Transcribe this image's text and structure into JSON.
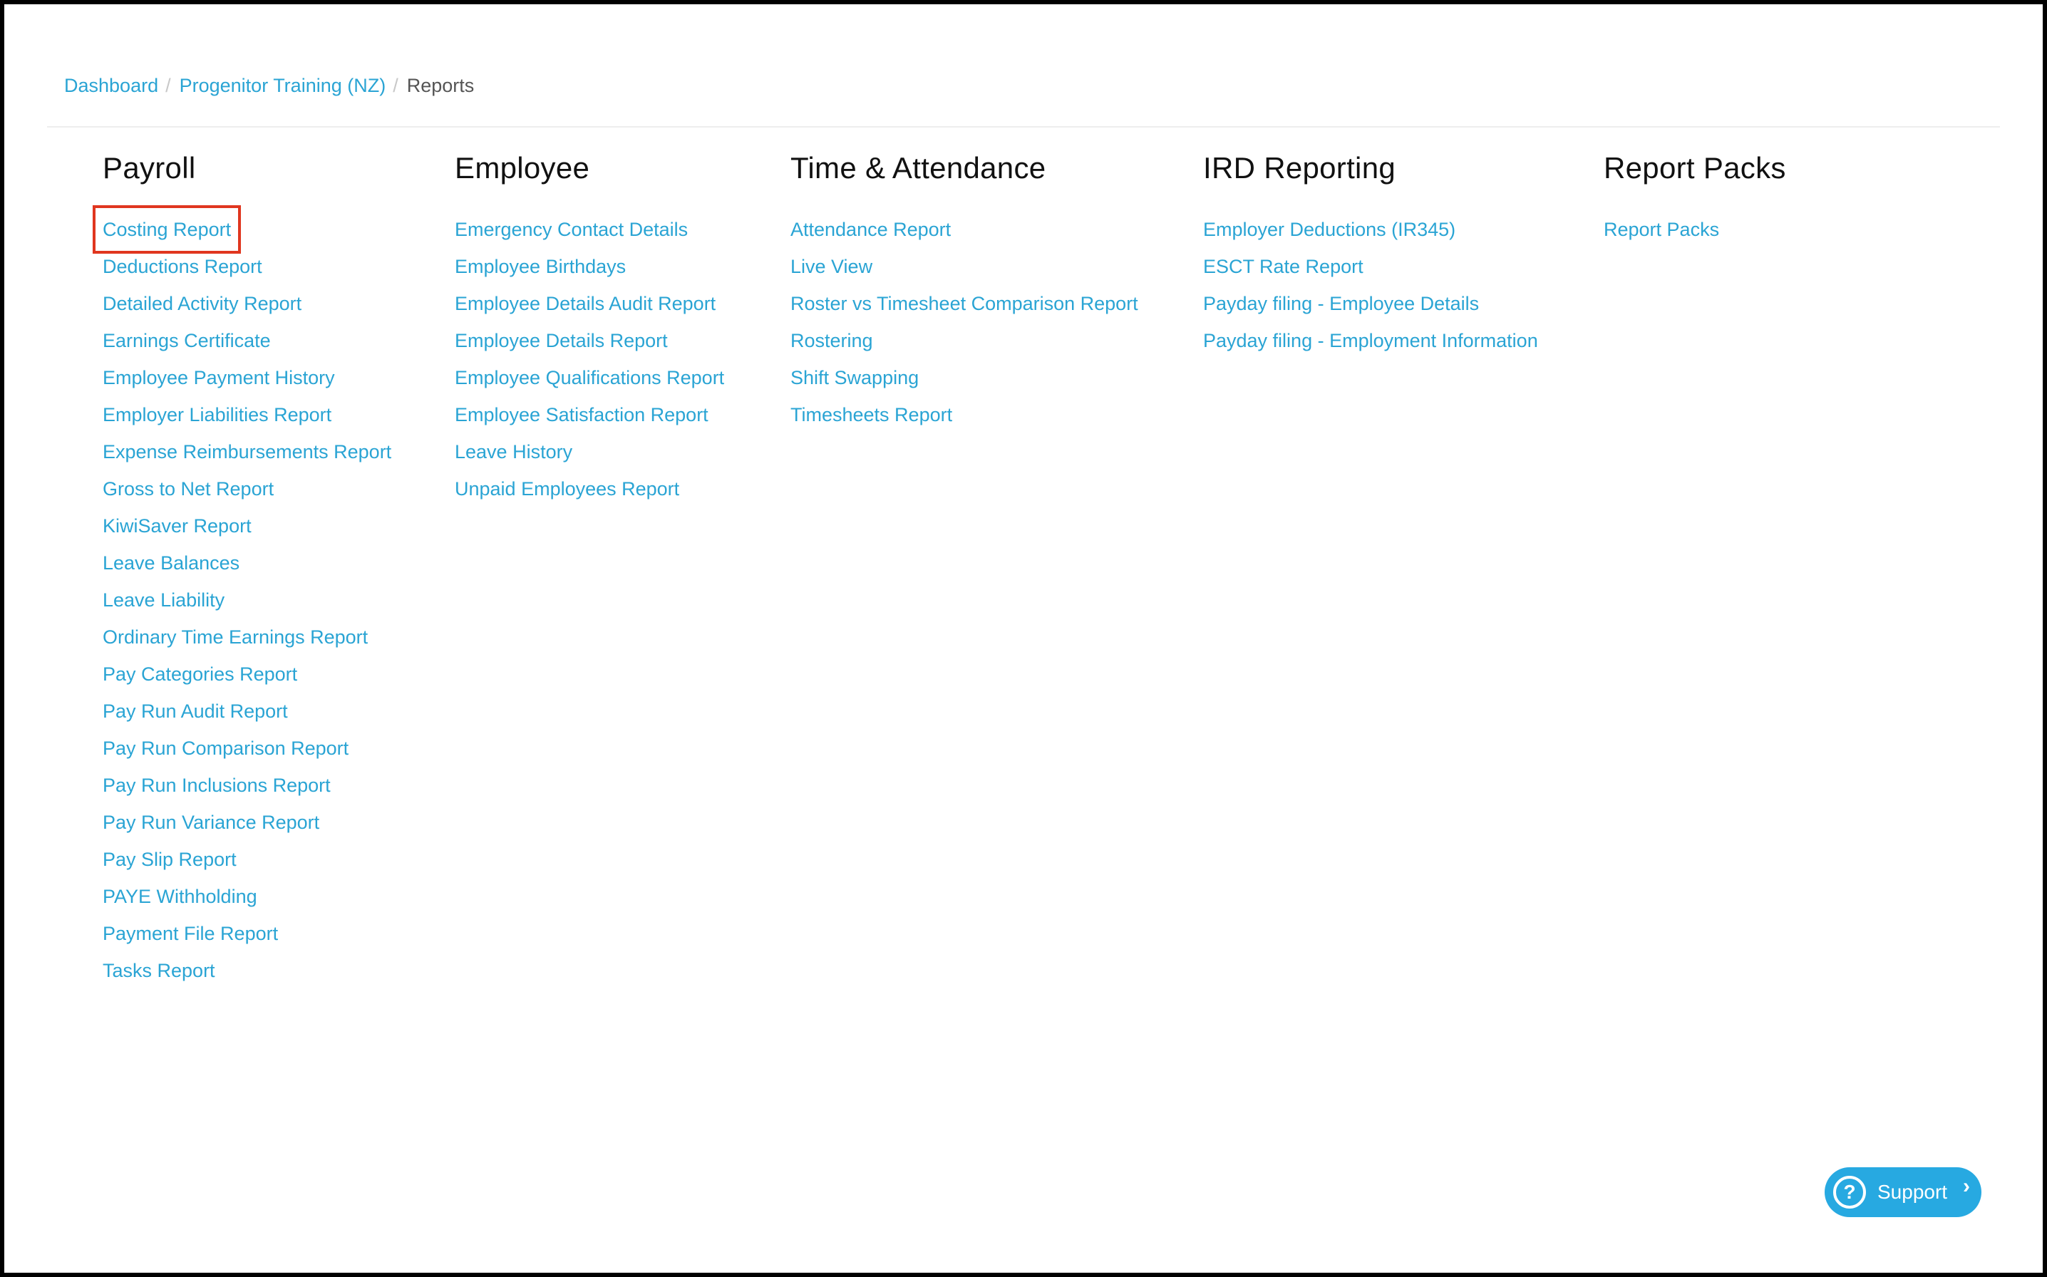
{
  "breadcrumb": {
    "items": [
      "Dashboard",
      "Progenitor Training (NZ)",
      "Reports"
    ],
    "separator": "/"
  },
  "columns": [
    {
      "title": "Payroll",
      "links": [
        "Costing Report",
        "Deductions Report",
        "Detailed Activity Report",
        "Earnings Certificate",
        "Employee Payment History",
        "Employer Liabilities Report",
        "Expense Reimbursements Report",
        "Gross to Net Report",
        "KiwiSaver Report",
        "Leave Balances",
        "Leave Liability",
        "Ordinary Time Earnings Report",
        "Pay Categories Report",
        "Pay Run Audit Report",
        "Pay Run Comparison Report",
        "Pay Run Inclusions Report",
        "Pay Run Variance Report",
        "Pay Slip Report",
        "PAYE Withholding",
        "Payment File Report",
        "Tasks Report"
      ]
    },
    {
      "title": "Employee",
      "links": [
        "Emergency Contact Details",
        "Employee Birthdays",
        "Employee Details Audit Report",
        "Employee Details Report",
        "Employee Qualifications Report",
        "Employee Satisfaction Report",
        "Leave History",
        "Unpaid Employees Report"
      ]
    },
    {
      "title": "Time & Attendance",
      "links": [
        "Attendance Report",
        "Live View",
        "Roster vs Timesheet Comparison Report",
        "Rostering",
        "Shift Swapping",
        "Timesheets Report"
      ]
    },
    {
      "title": "IRD Reporting",
      "links": [
        "Employer Deductions (IR345)",
        "ESCT Rate Report",
        "Payday filing - Employee Details",
        "Payday filing - Employment Information"
      ]
    },
    {
      "title": "Report Packs",
      "links": [
        "Report Packs"
      ]
    }
  ],
  "highlighted_link": "Costing Report",
  "support": {
    "label": "Support",
    "icon": "question-circle-icon",
    "chevron": "chevron-right-icon"
  },
  "colors": {
    "link": "#2aa4d4",
    "highlight_border": "#e0361f",
    "support_button": "#27a9e1"
  }
}
